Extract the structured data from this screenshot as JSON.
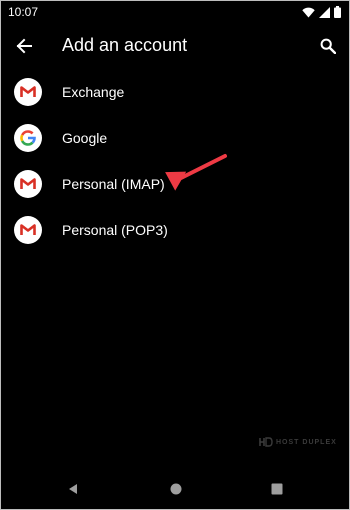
{
  "status_bar": {
    "time": "10:07"
  },
  "app_bar": {
    "title": "Add an account"
  },
  "accounts": [
    {
      "label": "Exchange",
      "icon": "gmail-icon"
    },
    {
      "label": "Google",
      "icon": "google-icon"
    },
    {
      "label": "Personal (IMAP)",
      "icon": "gmail-icon"
    },
    {
      "label": "Personal (POP3)",
      "icon": "gmail-icon"
    }
  ],
  "watermark": {
    "text": "HOST DUPLEX"
  },
  "colors": {
    "background": "#000000",
    "text": "#ffffff",
    "arrow": "#ee3a44"
  }
}
